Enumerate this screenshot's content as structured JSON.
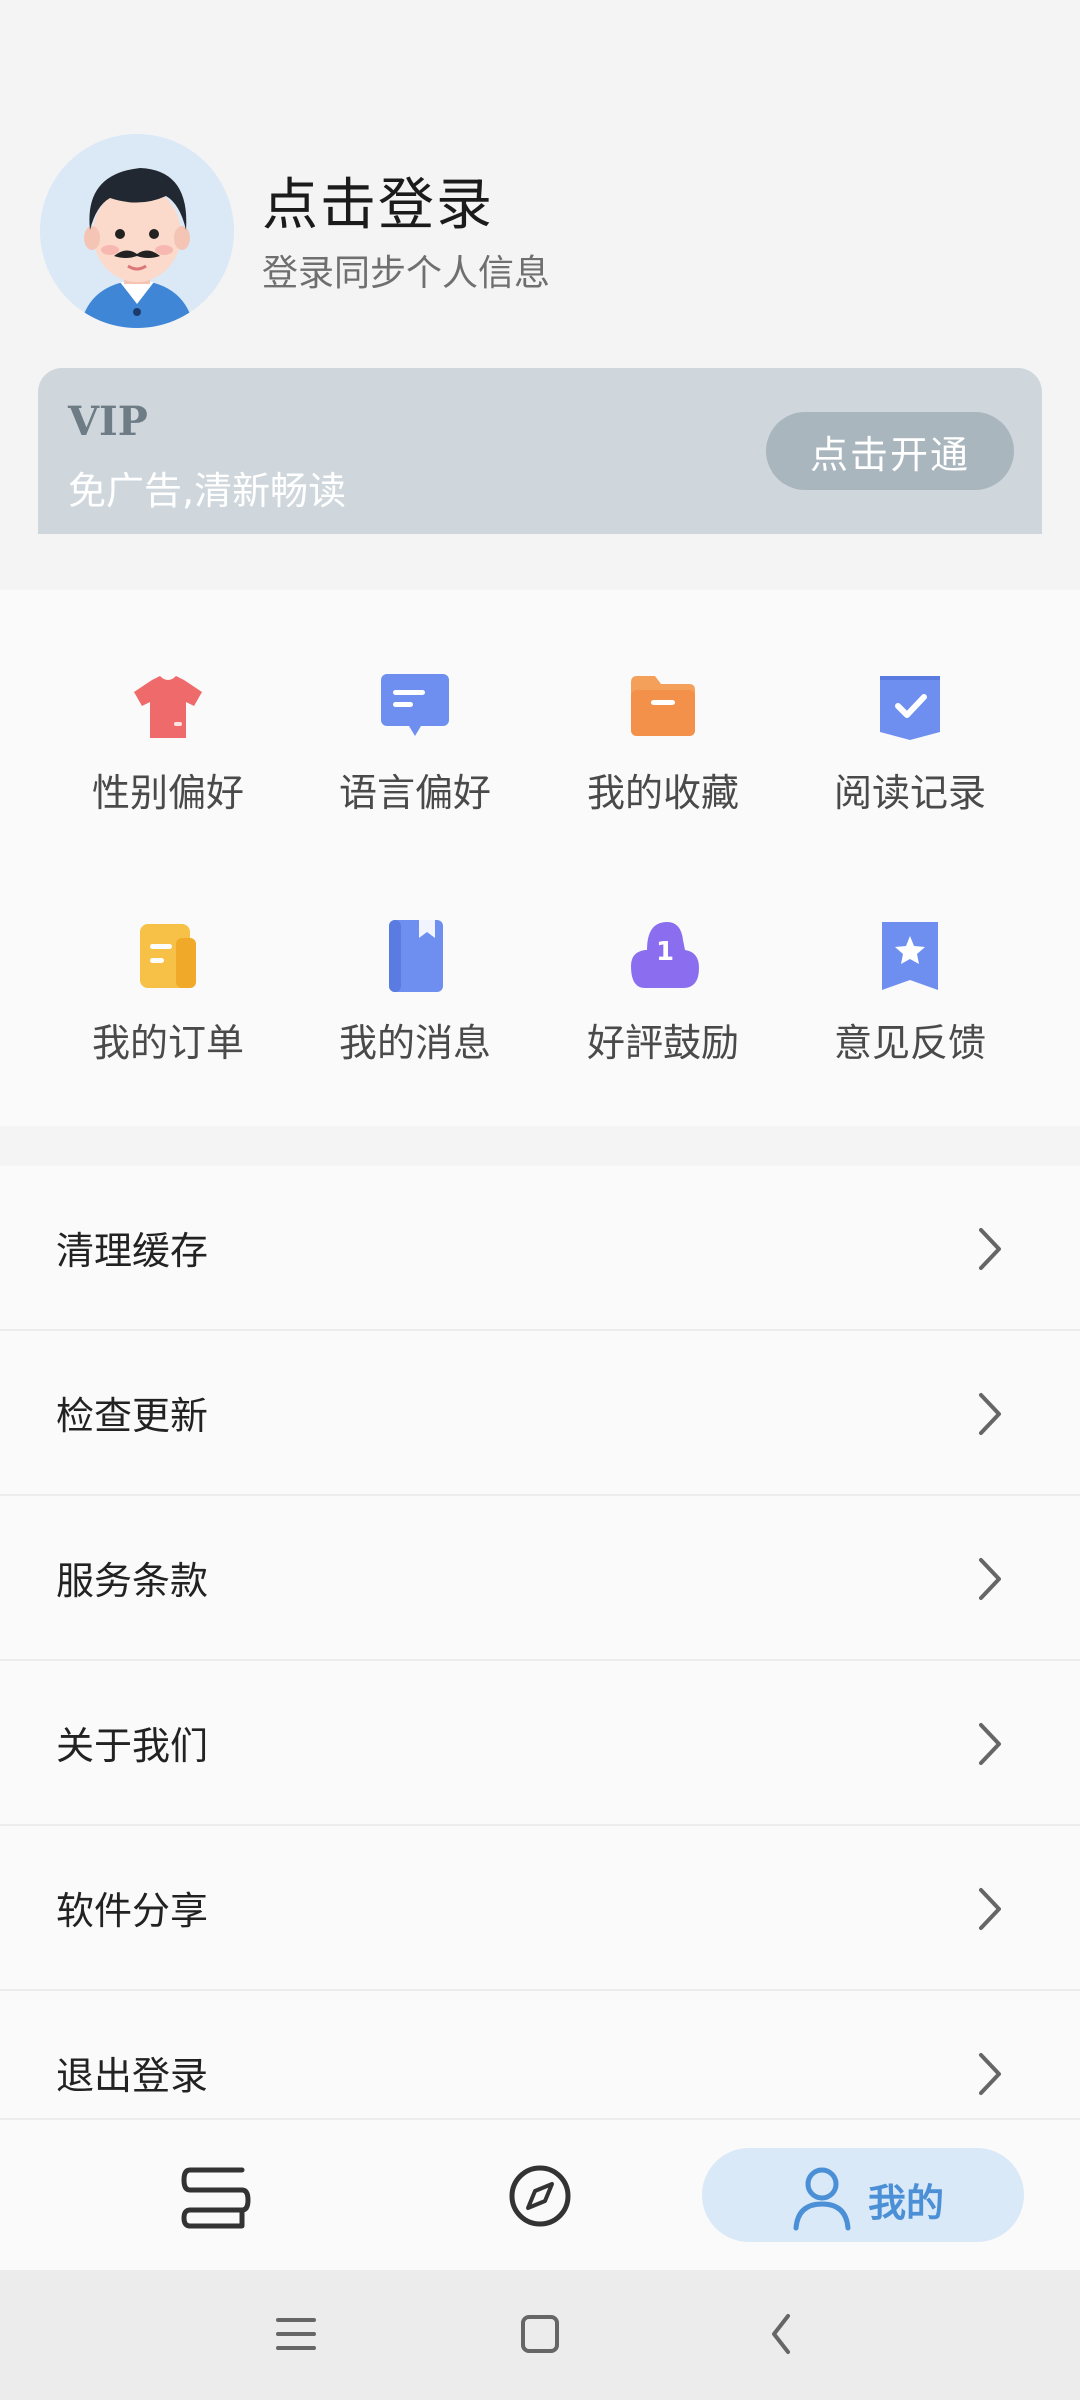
{
  "profile": {
    "title": "点击登录",
    "subtitle": "登录同步个人信息"
  },
  "vip": {
    "label": "VIP",
    "desc": "免广告,清新畅读",
    "button": "点击开通"
  },
  "grid": [
    {
      "label": "性别偏好",
      "icon": "tshirt-icon"
    },
    {
      "label": "语言偏好",
      "icon": "chat-bubble-icon"
    },
    {
      "label": "我的收藏",
      "icon": "folder-icon"
    },
    {
      "label": "阅读记录",
      "icon": "checkmark-shield-icon"
    },
    {
      "label": "我的订单",
      "icon": "document-icon"
    },
    {
      "label": "我的消息",
      "icon": "bookmark-book-icon"
    },
    {
      "label": "好評鼓励",
      "icon": "rating-number-icon"
    },
    {
      "label": "意见反馈",
      "icon": "star-badge-icon"
    }
  ],
  "list": [
    {
      "label": "清理缓存"
    },
    {
      "label": "检查更新"
    },
    {
      "label": "服务条款"
    },
    {
      "label": "关于我们"
    },
    {
      "label": "软件分享"
    },
    {
      "label": "退出登录"
    }
  ],
  "tabs": {
    "bookshelf_icon": "bookshelf-icon",
    "discover_icon": "compass-icon",
    "me_label": "我的",
    "me_icon": "person-icon"
  },
  "colors": {
    "vip_card": "#cfd7dc",
    "vip_button": "#a9b6bd",
    "active_tab": "#4b8fd6",
    "active_tab_bg": "#d9e9f8"
  }
}
